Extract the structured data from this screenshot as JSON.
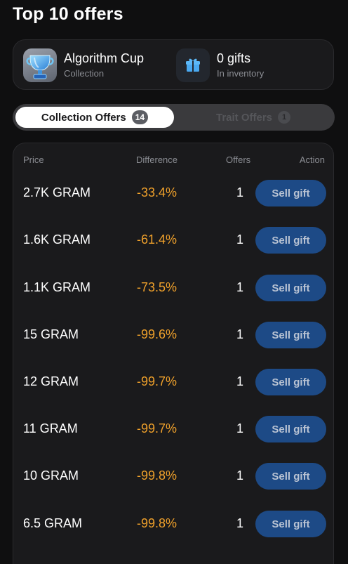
{
  "header": {
    "title": "Top 10 offers"
  },
  "collection": {
    "name": "Algorithm Cup",
    "type_label": "Collection",
    "icon": "trophy-icon"
  },
  "inventory": {
    "count_label": "0 gifts",
    "sub_label": "In inventory",
    "icon": "gift-icon"
  },
  "tabs": [
    {
      "label": "Collection Offers",
      "count": "14",
      "active": true
    },
    {
      "label": "Trait Offers",
      "count": "1",
      "active": false
    }
  ],
  "table": {
    "headers": {
      "price": "Price",
      "difference": "Difference",
      "offers": "Offers",
      "action": "Action"
    },
    "rows": [
      {
        "price": "2.7K GRAM",
        "difference": "-33.4%",
        "offers": "1",
        "action": "Sell gift"
      },
      {
        "price": "1.6K GRAM",
        "difference": "-61.4%",
        "offers": "1",
        "action": "Sell gift"
      },
      {
        "price": "1.1K GRAM",
        "difference": "-73.5%",
        "offers": "1",
        "action": "Sell gift"
      },
      {
        "price": "15 GRAM",
        "difference": "-99.6%",
        "offers": "1",
        "action": "Sell gift"
      },
      {
        "price": "12 GRAM",
        "difference": "-99.7%",
        "offers": "1",
        "action": "Sell gift"
      },
      {
        "price": "11 GRAM",
        "difference": "-99.7%",
        "offers": "1",
        "action": "Sell gift"
      },
      {
        "price": "10 GRAM",
        "difference": "-99.8%",
        "offers": "1",
        "action": "Sell gift"
      },
      {
        "price": "6.5 GRAM",
        "difference": "-99.8%",
        "offers": "1",
        "action": "Sell gift"
      }
    ]
  },
  "colors": {
    "background": "#0f0f10",
    "card": "#1a1a1c",
    "difference_text": "#f0a12b",
    "button": "#1d4a86",
    "button_text": "#b9c3d3"
  }
}
